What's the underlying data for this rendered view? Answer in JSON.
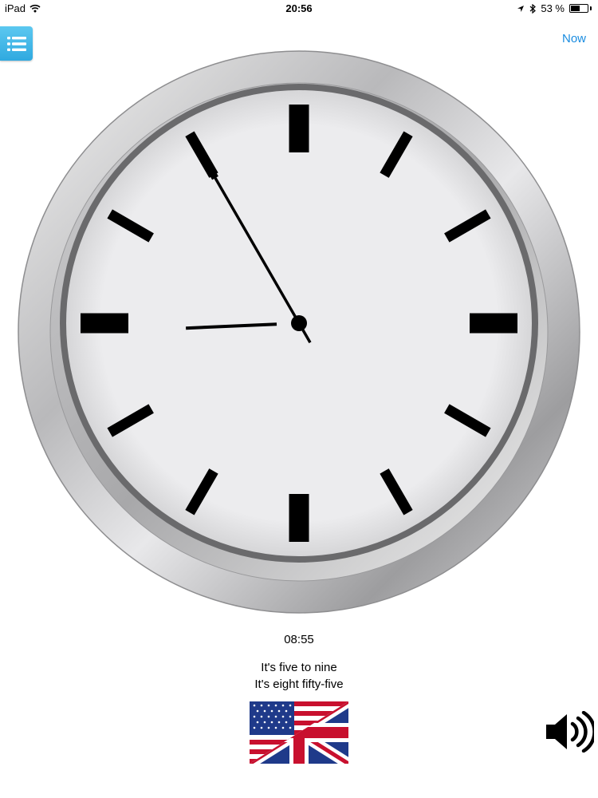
{
  "status_bar": {
    "device": "iPad",
    "time": "20:56",
    "battery": "53 %",
    "battery_level": 0.53
  },
  "header": {
    "menu_icon": "list-icon",
    "now_label": "Now"
  },
  "clock": {
    "hour": 8,
    "minute": 55
  },
  "display": {
    "digital_time": "08:55",
    "phrase_1": "It's five to nine",
    "phrase_2": "It's eight fifty-five"
  },
  "language": {
    "flag_icon": "us-uk-flag-icon"
  },
  "audio": {
    "icon": "speaker-icon"
  },
  "colors": {
    "accent": "#1a8ce0",
    "menu_button": "#3db4e6",
    "face": "#ececee"
  }
}
